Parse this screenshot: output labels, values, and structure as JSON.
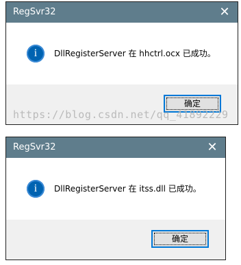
{
  "dialogs": [
    {
      "title": "RegSvr32",
      "close_glyph": "✕",
      "icon_glyph": "i",
      "message": "DllRegisterServer 在 hhctrl.ocx 已成功。",
      "ok_label": "确定"
    },
    {
      "title": "RegSvr32",
      "close_glyph": "✕",
      "icon_glyph": "i",
      "message": "DllRegisterServer 在 itss.dll 已成功。",
      "ok_label": "确定"
    }
  ],
  "watermark": "https://blog.csdn.net/qq_41892229",
  "colors": {
    "titlebar": "#5f7d8c",
    "button_border": "#0078d7",
    "info_icon": "#0063b1"
  }
}
